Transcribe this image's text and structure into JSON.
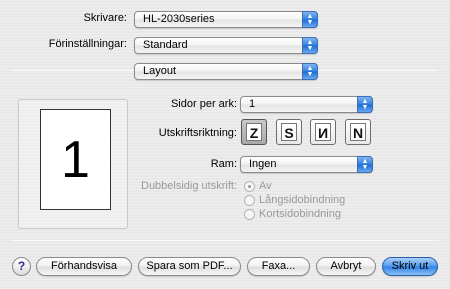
{
  "printer": {
    "label": "Skrivare:",
    "value": "HL-2030series"
  },
  "presets": {
    "label": "Förinställningar:",
    "value": "Standard"
  },
  "panel": {
    "value": "Layout"
  },
  "layout": {
    "pages_per_sheet": {
      "label": "Sidor per ark:",
      "value": "1"
    },
    "direction": {
      "label": "Utskriftsriktning:",
      "options": [
        "Z",
        "S",
        "N",
        "N"
      ]
    },
    "border": {
      "label": "Ram:",
      "value": "Ingen"
    },
    "duplex": {
      "label": "Dubbelsidig utskrift:",
      "options": [
        "Av",
        "Långsidobindning",
        "Kortsidobindning"
      ]
    },
    "preview_page_number": "1"
  },
  "buttons": {
    "help": "?",
    "preview": "Förhandsvisa",
    "save_pdf": "Spara som PDF...",
    "fax": "Faxa...",
    "cancel": "Avbryt",
    "print": "Skriv ut"
  }
}
